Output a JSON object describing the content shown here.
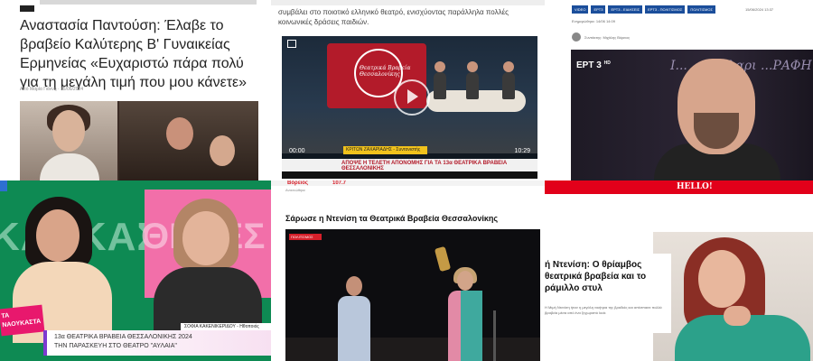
{
  "tile1": {
    "headline": "Αναστασία Παντούση: Έλαβε το βραβείο Καλύτερης Β' Γυναικείας Ερμηνείας «Ευχαριστώ πάρα πολύ για τη μεγάλη τιμή που μου κάνετε»",
    "byline": "Από Μαρία Γιάννη · 15/06/2024"
  },
  "tile2": {
    "text": "συμβάλει στο ποιοτικό ελληνικό θεατρό, ενισχύοντας παράλληλα πολλές κοινωνικές δράσεις παιδιών.",
    "logo_text": "Θεατρικά Βραβεία Θεσσαλονίκης",
    "lower_name": "ΚΡΙΤΩΝ ΖΑΧΑΡΙΑΔΗΣ - Συντονιστής",
    "lower_text": "ΑΠΟΨΕ Η ΤΕΛΕΤΗ ΑΠΟΝΟΜΗΣ ΓΙΑ ΤΑ 13α ΘΕΑΤΡΙΚΑ ΒΡΑΒΕΙΑ ΘΕΣΣΑΛΟΝΙΚΗΣ",
    "time_now": "00:00",
    "time_end": "10:29"
  },
  "tile3": {
    "chips": [
      "VIDEO",
      "ΕΡΤ3",
      "ΕΡΤ3 - ΕΙΔΗΣΕΙΣ",
      "ΕΡΤ3 - ΠΟΛΙΤΙΣΜΟΣ",
      "ΠΟΛΙΤΙΣΜΟΣ"
    ],
    "date": "15/06/2024 13:37",
    "updated": "Ενημερώθηκε: 14/06 14:09",
    "author": "Συντάκτης: Μιχάλης Βόρειος",
    "channel": "ΕΡΤ 3",
    "channel_hd": "HD",
    "deco": "Ι... ...ρακλαρι ...ΡΑΦΗ"
  },
  "tile4": {
    "bg_text": "ΚΑΛΚΑΣ ΑΘΕΒΕΣ",
    "show_logo": "ΤΑ ΝΑΟΥΚΑΣΤΑ",
    "name_tag": "ΣΟΦΙΑ ΚΑΚΕΝΙΚΕΡΙΔΟΥ - Ηθοποιός",
    "caption_line1": "13α ΘΕΑΤΡΙΚΑ ΒΡΑΒΕΙΑ ΘΕΣΣΑΛΟΝΙΚΗΣ 2024",
    "caption_line2": "ΤΗΝ ΠΑΡΑΣΚΕΥΗ ΣΤΟ ΘΕΑΤΡΟ \"ΑΥΛΑΙΑ\""
  },
  "tile5": {
    "site_logo": "Βόρειος",
    "site_number": "107.7",
    "updated": "Ανανεώθηκε",
    "title": "Σάρωσε η Ντενίση τα Θεατρικά Βραβεία Θεσσαλονίκης",
    "tag": "ΠΟΛΙΤΙΣΜΟΣ"
  },
  "tile6": {
    "brand": "HELLO!",
    "headline": "ή Ντενίση: Ο θρίαμβος θεατρικά βραβεία και το ράμιλλο στυλ",
    "subtext": "Η Μιμή Ντενίση ήταν η μεγάλη νικήτρια της βραδιάς και απέσπασε πολλά βραβεία μέσα από ένα ξεχωριστό look"
  }
}
